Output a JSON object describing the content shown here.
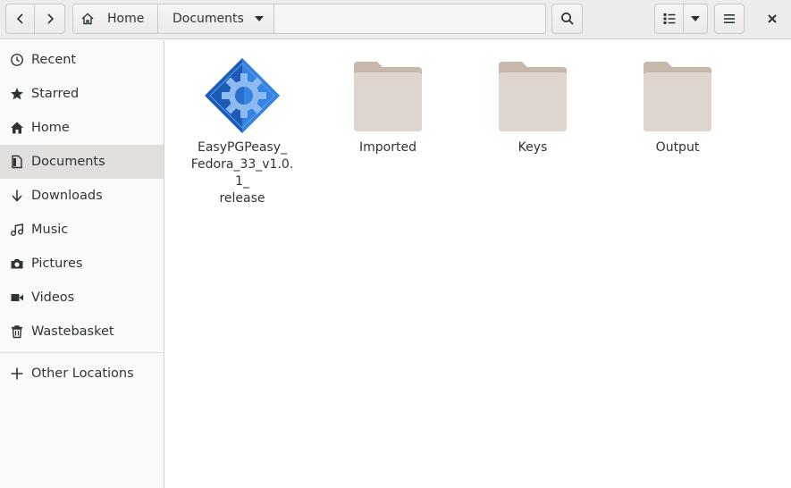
{
  "toolbar": {
    "back_icon": "chevron-left-icon",
    "forward_icon": "chevron-right-icon",
    "search_icon": "search-icon",
    "view_icon": "list-view-icon",
    "view_options_icon": "caret-down-icon",
    "menu_icon": "hamburger-menu-icon",
    "close_icon": "close-icon"
  },
  "pathbar": {
    "home_label": "Home",
    "current_label": "Documents"
  },
  "sidebar": {
    "items": [
      {
        "label": "Recent",
        "icon": "clock-icon"
      },
      {
        "label": "Starred",
        "icon": "star-icon"
      },
      {
        "label": "Home",
        "icon": "home-icon"
      },
      {
        "label": "Documents",
        "icon": "document-icon",
        "active": true
      },
      {
        "label": "Downloads",
        "icon": "download-icon"
      },
      {
        "label": "Music",
        "icon": "music-icon"
      },
      {
        "label": "Pictures",
        "icon": "camera-icon"
      },
      {
        "label": "Videos",
        "icon": "video-icon"
      },
      {
        "label": "Wastebasket",
        "icon": "trash-icon"
      }
    ],
    "other_locations": {
      "label": "Other Locations",
      "icon": "plus-icon"
    }
  },
  "files": [
    {
      "name": "EasyPGPeasy_\nFedora_33_v1.0.1_\nrelease",
      "type": "application",
      "icon": "app-gear-icon"
    },
    {
      "name": "Imported",
      "type": "folder",
      "icon": "folder-icon"
    },
    {
      "name": "Keys",
      "type": "folder",
      "icon": "folder-icon"
    },
    {
      "name": "Output",
      "type": "folder",
      "icon": "folder-icon"
    }
  ],
  "colors": {
    "accent_blue": "#3584e4",
    "folder": "#d7cfc5",
    "sidebar_active": "#e1dedb"
  }
}
